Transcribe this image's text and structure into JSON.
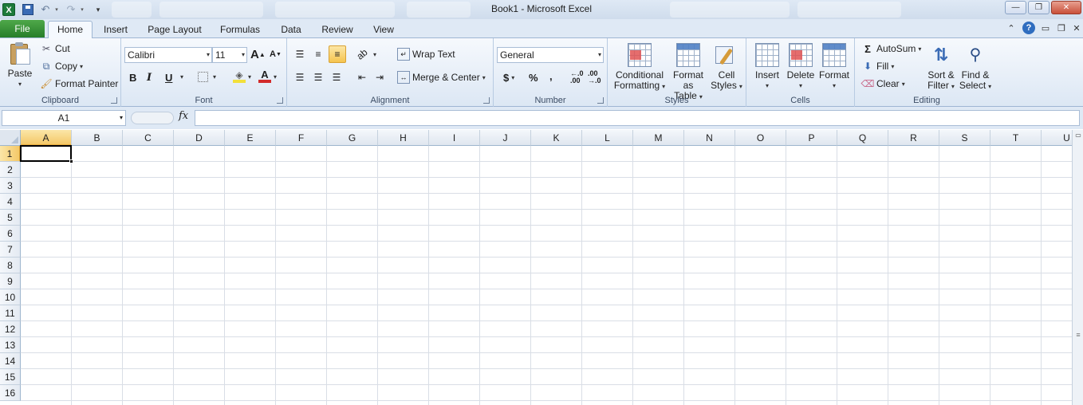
{
  "window": {
    "title": "Book1  -  Microsoft Excel",
    "app_icon": "X",
    "controls": {
      "minimize": "—",
      "restore": "❐",
      "close": "✕"
    }
  },
  "tabs": {
    "file": "File",
    "home": "Home",
    "insert": "Insert",
    "page_layout": "Page Layout",
    "formulas": "Formulas",
    "data": "Data",
    "review": "Review",
    "view": "View"
  },
  "clipboard": {
    "label": "Clipboard",
    "paste": "Paste",
    "cut": "Cut",
    "copy": "Copy",
    "format_painter": "Format Painter"
  },
  "font": {
    "label": "Font",
    "name": "Calibri",
    "size": "11",
    "grow": "A",
    "shrink": "A",
    "bold": "B",
    "italic": "I",
    "underline": "U",
    "font_color_letter": "A",
    "fill_color": "#f2e03a",
    "font_color": "#d22b2b"
  },
  "alignment": {
    "label": "Alignment",
    "wrap_text": "Wrap Text",
    "merge_center": "Merge & Center"
  },
  "number": {
    "label": "Number",
    "format": "General",
    "currency": "$",
    "percent": "%",
    "comma": ",",
    "increase_decimal": "←.0\n.00",
    "decrease_decimal": ".00\n→.0"
  },
  "styles": {
    "label": "Styles",
    "conditional_1": "Conditional",
    "conditional_2": "Formatting",
    "format_table_1": "Format",
    "format_table_2": "as Table",
    "cell_styles_1": "Cell",
    "cell_styles_2": "Styles"
  },
  "cells": {
    "label": "Cells",
    "insert": "Insert",
    "delete": "Delete",
    "format": "Format"
  },
  "editing": {
    "label": "Editing",
    "autosum": "AutoSum",
    "sigma": "Σ",
    "fill": "Fill",
    "clear": "Clear",
    "sort_1": "Sort &",
    "sort_2": "Filter",
    "find_1": "Find &",
    "find_2": "Select"
  },
  "formula_bar": {
    "name_box": "A1",
    "fx": "fx",
    "content": ""
  },
  "sheet": {
    "columns": [
      "A",
      "B",
      "C",
      "D",
      "E",
      "F",
      "G",
      "H",
      "I",
      "J",
      "K",
      "L",
      "M",
      "N",
      "O",
      "P",
      "Q",
      "R",
      "S",
      "T",
      "U"
    ],
    "rows": [
      "1",
      "2",
      "3",
      "4",
      "5",
      "6",
      "7",
      "8",
      "9",
      "10",
      "11",
      "12",
      "13",
      "14",
      "15",
      "16"
    ],
    "active_column": "A",
    "active_row": "1"
  }
}
